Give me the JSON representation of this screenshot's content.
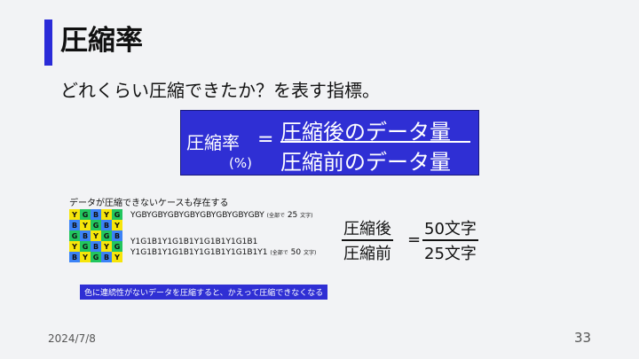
{
  "slide": {
    "title": "圧縮率",
    "subtitle": "どれくらい圧縮できたか？を表す指標。",
    "date": "2024/7/8",
    "page_number": "33"
  },
  "formula": {
    "left": "圧縮率",
    "left_unit": "(%)",
    "equals": "=",
    "numerator": "圧縮後のデータ量",
    "denominator": "圧縮前のデータ量"
  },
  "example": {
    "case_title": "データが圧縮できないケースも存在する",
    "grid": [
      [
        "Y",
        "G",
        "B",
        "Y",
        "G"
      ],
      [
        "B",
        "Y",
        "G",
        "B",
        "Y"
      ],
      [
        "G",
        "B",
        "Y",
        "G",
        "B"
      ],
      [
        "Y",
        "G",
        "B",
        "Y",
        "G"
      ],
      [
        "B",
        "Y",
        "G",
        "B",
        "Y"
      ]
    ],
    "cell_colors": {
      "Y": "#f6e50a",
      "G": "#22c55e",
      "B": "#3b82f6"
    },
    "raw_string": "YGBYGBYGBYGBYGBYGBYGBYGBY",
    "raw_note": "(全部で",
    "raw_count": "25",
    "raw_unit": "文字)",
    "encoded_line1": "Y1G1B1Y1G1B1Y1G1B1Y1G1B1",
    "encoded_line2": "Y1G1B1Y1G1B1Y1G1B1Y1G1B1Y1",
    "encoded_note": "(全部で",
    "encoded_count": "50",
    "encoded_unit": "文字)",
    "note": "色に連続性がないデータを圧縮すると、かえって圧縮できなくなる"
  },
  "ratio": {
    "left_num": "圧縮後",
    "left_den": "圧縮前",
    "equals": "=",
    "right_num": "50文字",
    "right_den": "25文字"
  }
}
